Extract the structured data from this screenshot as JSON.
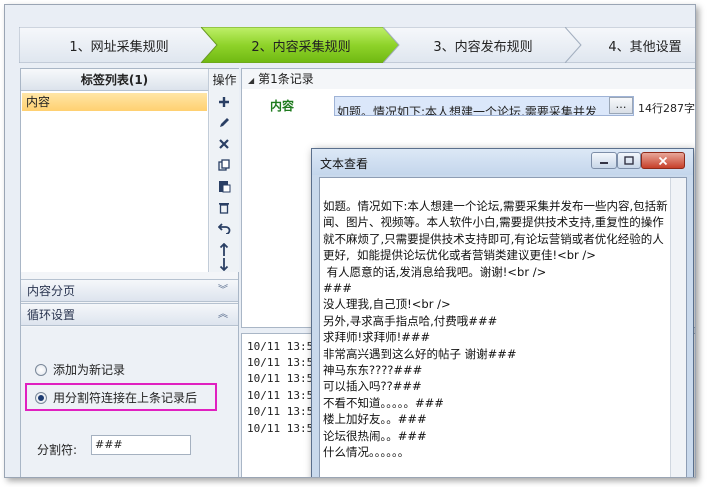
{
  "steps": [
    {
      "label": "1、网址采集规则",
      "active": false
    },
    {
      "label": "2、内容采集规则",
      "active": true
    },
    {
      "label": "3、内容发布规则",
      "active": false
    },
    {
      "label": "4、其他设置",
      "active": false
    }
  ],
  "tag_list": {
    "header": "标签列表(1)",
    "items": [
      "内容"
    ]
  },
  "ops": {
    "title": "操作",
    "icons": [
      "plus-icon",
      "pencil-icon",
      "delete-x-icon",
      "copy-icon",
      "paste-icon",
      "trash-icon",
      "undo-icon",
      "arrow-up-icon",
      "arrow-down-icon"
    ]
  },
  "sections": {
    "paging": "内容分页",
    "loop": "循环设置"
  },
  "loop": {
    "option_new": "添加为新记录",
    "option_append": "用分割符连接在上条记录后",
    "selected": "append",
    "separator_label": "分割符:",
    "separator_value": "###"
  },
  "record": {
    "title": "第1条记录",
    "field_name": "内容",
    "field_value": "如题。情况如下:本人想建一个论坛,需要采集并发",
    "ellipsis": "…",
    "stats": "14行287字"
  },
  "log": [
    "10/11 13:50",
    "10/11 13:50",
    "10/11 13:50",
    "10/11 13:50",
    "10/11 13:50",
    "10/11 13:50"
  ],
  "dialog": {
    "title": "文本查看",
    "text": "如题。情况如下:本人想建一个论坛,需要采集并发布一些内容,包括新闻、图片、视频等。本人软件小白,需要提供技术支持,重复性的操作就不麻烦了,只需要提供技术支持即可,有论坛营销或者优化经验的人更好,  如能提供论坛优化或者营销类建议更佳!<br />\n 有人愿意的话,发消息给我吧。谢谢!<br />\n###\n没人理我,自己顶!<br />\n另外,寻求高手指点哈,付费哦###\n求拜师!求拜师!###\n非常高兴遇到这么好的帖子 谢谢###\n神马东东????###\n可以插入吗??###\n不看不知道。。。。。###\n楼上加好友。。###\n论坛很热闹。。###\n什么情况。。。。。。"
  },
  "colors": {
    "active_step": "#7cc41c",
    "selection": "#ffd070",
    "highlight": "#e020c0",
    "field_name": "#1e7a1e"
  }
}
